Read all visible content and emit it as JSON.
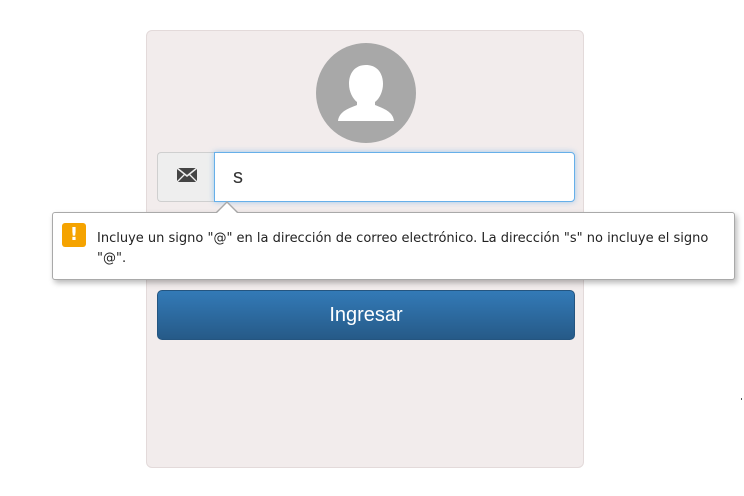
{
  "login": {
    "avatar_icon": "user-silhouette-icon",
    "email_icon": "envelope-icon",
    "email_value": "s",
    "submit_label": "Ingresar",
    "button_color": "#2e6da4",
    "card_background": "#f2ecec"
  },
  "validation_tooltip": {
    "icon": "warning-icon",
    "icon_color": "#f5a300",
    "message": "Incluye un signo \"@\" en la dirección de correo electrónico. La dirección \"s\" no incluye el signo \"@\"."
  }
}
